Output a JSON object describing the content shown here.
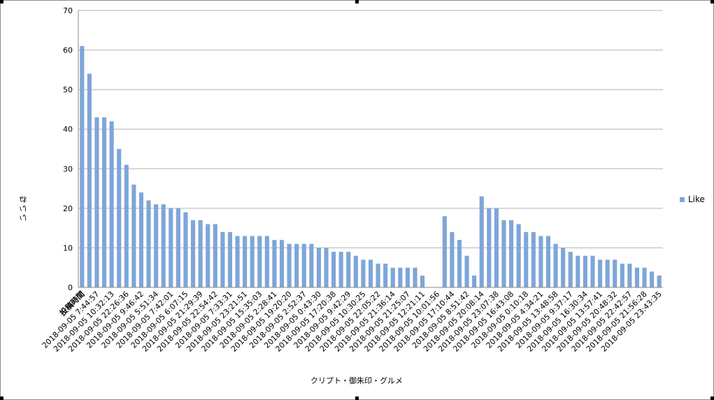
{
  "colors": {
    "bar": "#7ea6d8",
    "grid": "#b3b3b3",
    "axis": "#888888"
  },
  "chart_data": {
    "type": "bar",
    "xlabel": "クリプト・御朱印・グルメ",
    "ylabel": "いいね",
    "ylim": [
      0,
      70
    ],
    "yticks": [
      0,
      10,
      20,
      30,
      40,
      50,
      60,
      70
    ],
    "grid": true,
    "legend_position": "right",
    "series": [
      {
        "name": "Like",
        "values": [
          61,
          54,
          43,
          43,
          42,
          35,
          31,
          26,
          24,
          22,
          21,
          21,
          20,
          20,
          19,
          17,
          17,
          16,
          16,
          14,
          14,
          13,
          13,
          13,
          13,
          13,
          12,
          12,
          11,
          11,
          11,
          11,
          10,
          10,
          9,
          9,
          9,
          8,
          7,
          7,
          6,
          6,
          5,
          5,
          5,
          5,
          3,
          0,
          0,
          18,
          14,
          12,
          8,
          3,
          23,
          20,
          20,
          17,
          17,
          16,
          14,
          14,
          13,
          13,
          11,
          10,
          9,
          8,
          8,
          8,
          7,
          7,
          7,
          6,
          6,
          5,
          5,
          4,
          3
        ]
      }
    ],
    "categories": [
      "投稿時間",
      "",
      "2018-09-05 7:44:57",
      "",
      "2018-09-05 10:32:13",
      "",
      "2018-09-05 22:26:36",
      "",
      "2018-09-05 9:46:42",
      "",
      "2018-09-05 5:51:34",
      "",
      "2018-09-05 7:42:01",
      "",
      "2018-09-05 6:07:15",
      "",
      "2018-09-05 21:29:39",
      "",
      "2018-09-05 22:54:42",
      "",
      "2018-09-05 7:33:31",
      "",
      "2018-09-05 23:21:51",
      "",
      "2018-09-05 15:35:03",
      "",
      "2018-09-05 2:28:41",
      "",
      "2018-09-05 19:20:20",
      "",
      "2018-09-05 2:52:37",
      "",
      "2018-09-05 0:43:30",
      "",
      "2018-09-05 17:20:38",
      "",
      "2018-09-05 9:42:29",
      "",
      "2018-09-05 10:30:25",
      "",
      "2018-09-05 22:05:22",
      "",
      "2018-09-05 21:36:14",
      "",
      "2018-09-05 21:25:07",
      "",
      "2018-09-05 12:21:11",
      "",
      "2018-09-05 10:01:56",
      "",
      "2018-09-05 17:10:44",
      "",
      "2018-09-05 8:51:42",
      "",
      "2018-09-05 20:08:14",
      "",
      "2018-09-05 23:07:38",
      "",
      "2018-09-05 16:43:08",
      "",
      "2018-09-05 0:10:18",
      "",
      "2018-09-05 4:34:21",
      "",
      "2018-09-05 13:48:58",
      "",
      "2018-09-05 9:37:17",
      "",
      "2018-09-05 16:30:34",
      "",
      "2018-09-05 13:57:41",
      "",
      "2018-09-05 20:48:32",
      "",
      "2018-09-05 22:42:57",
      "",
      "2018-09-05 21:56:28",
      "",
      "2018-09-05 23:43:35"
    ]
  }
}
